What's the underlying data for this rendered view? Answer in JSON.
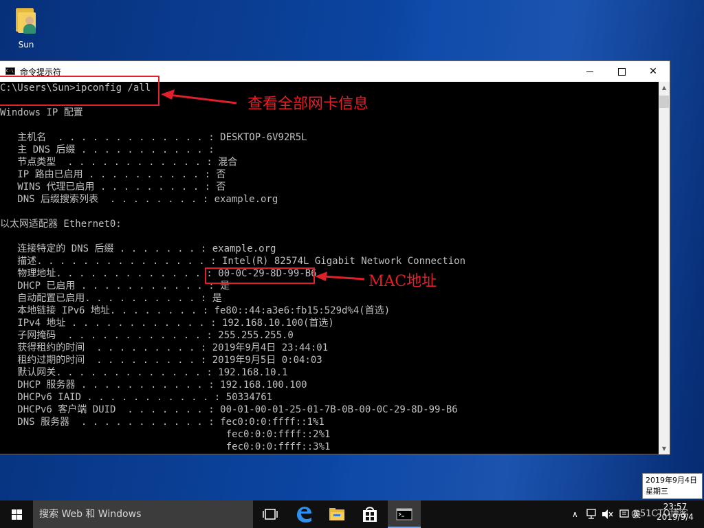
{
  "desktop": {
    "icons": [
      {
        "label": "Sun",
        "icon": "user-folder-icon"
      }
    ]
  },
  "window": {
    "title": "命令提示符",
    "controls": {
      "minimize": "minimize-icon",
      "maximize": "maximize-icon",
      "close": "close-icon",
      "close_glyph": "✕"
    }
  },
  "console": {
    "lines": [
      "C:\\Users\\Sun>ipconfig /all",
      "",
      "Windows IP 配置",
      "",
      "   主机名  . . . . . . . . . . . . . : DESKTOP-6V92R5L",
      "   主 DNS 后缀 . . . . . . . . . . . :",
      "   节点类型  . . . . . . . . . . . . : 混合",
      "   IP 路由已启用 . . . . . . . . . . : 否",
      "   WINS 代理已启用 . . . . . . . . . : 否",
      "   DNS 后缀搜索列表  . . . . . . . . : example.org",
      "",
      "以太网适配器 Ethernet0:",
      "",
      "   连接特定的 DNS 后缀 . . . . . . . : example.org",
      "   描述. . . . . . . . . . . . . . . : Intel(R) 82574L Gigabit Network Connection",
      "   物理地址. . . . . . . . . . . . . : 00-0C-29-8D-99-B6",
      "   DHCP 已启用 . . . . . . . . . . . : 是",
      "   自动配置已启用. . . . . . . . . . : 是",
      "   本地链接 IPv6 地址. . . . . . . . : fe80::44:a3e6:fb15:529d%4(首选)",
      "   IPv4 地址 . . . . . . . . . . . . : 192.168.10.100(首选)",
      "   子网掩码  . . . . . . . . . . . . : 255.255.255.0",
      "   获得租约的时间  . . . . . . . . . : 2019年9月4日 23:44:01",
      "   租约过期的时间  . . . . . . . . . : 2019年9月5日 0:04:03",
      "   默认网关. . . . . . . . . . . . . : 192.168.10.1",
      "   DHCP 服务器 . . . . . . . . . . . : 192.168.100.100",
      "   DHCPv6 IAID . . . . . . . . . . . : 50334761",
      "   DHCPv6 客户端 DUID  . . . . . . . : 00-01-00-01-25-01-7B-0B-00-0C-29-8D-99-B6",
      "   DNS 服务器  . . . . . . . . . . . : fec0:0:0:ffff::1%1",
      "                                       fec0:0:0:ffff::2%1",
      "                                       fec0:0:0:ffff::3%1"
    ]
  },
  "annotations": {
    "command_note": "查看全部网卡信息",
    "mac_note": "MAC地址",
    "color": "#e0202a"
  },
  "tooltip": {
    "date": "2019年9月4日",
    "weekday": "星期三"
  },
  "taskbar": {
    "search_placeholder": "搜索 Web 和 Windows",
    "apps": [
      "task-view-icon",
      "edge-icon",
      "file-explorer-icon",
      "store-icon",
      "command-prompt-icon"
    ],
    "tray": {
      "ime": "英",
      "watermark": "@51CTO博客"
    },
    "clock": {
      "time": "23:57",
      "date": "2019/9/4"
    }
  },
  "colors": {
    "console_bg": "#000000",
    "console_text": "#c0c0c0",
    "taskbar": "#101010",
    "search_box": "#3c3c3c"
  }
}
